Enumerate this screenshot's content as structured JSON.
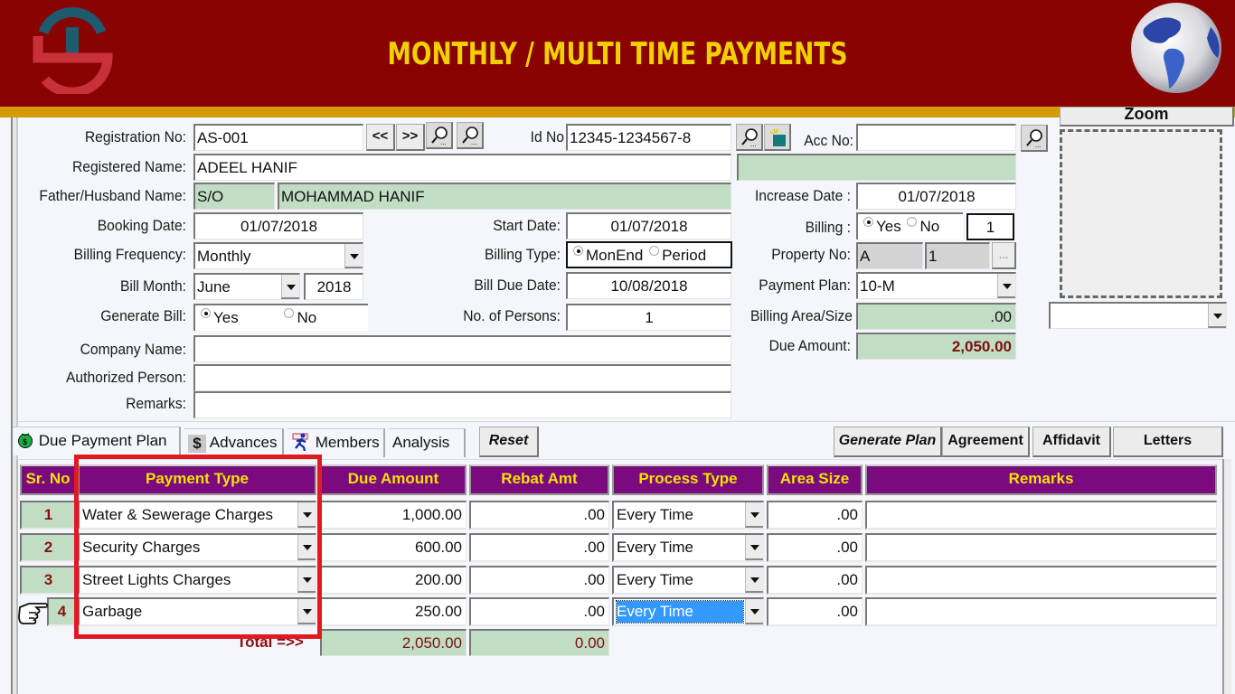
{
  "header": {
    "title": "MONTHLY / MULTI TIME PAYMENTS",
    "colors": {
      "banner": "#8a0303",
      "band": "#d49a08",
      "title": "#f0d000"
    }
  },
  "form": {
    "registration_no": {
      "label": "Registration No:",
      "value": "AS-001"
    },
    "nav": {
      "prev": "<<",
      "next": ">>"
    },
    "id_no": {
      "label": "Id No",
      "value": "12345-1234567-8"
    },
    "acc_no": {
      "label": "Acc No:",
      "value": ""
    },
    "registered_name": {
      "label": "Registered Name:",
      "value": "ADEEL HANIF"
    },
    "registered_name_extra": "",
    "father_husband": {
      "label": "Father/Husband Name:",
      "relation": "S/O",
      "value": "MOHAMMAD HANIF"
    },
    "increase_date": {
      "label": "Increase Date :",
      "value": "01/07/2018"
    },
    "booking_date": {
      "label": "Booking Date:",
      "value": "01/07/2018"
    },
    "start_date": {
      "label": "Start Date:",
      "value": "01/07/2018"
    },
    "billing": {
      "label": "Billing :",
      "options": [
        "Yes",
        "No"
      ],
      "selected": "Yes",
      "count": "1"
    },
    "billing_frequency": {
      "label": "Billing Frequency:",
      "value": "Monthly"
    },
    "billing_type": {
      "label": "Billing Type:",
      "options": [
        "MonEnd",
        "Period"
      ],
      "selected": "MonEnd"
    },
    "property_no": {
      "label": "Property No:",
      "block": "A",
      "number": "1",
      "browse": "..."
    },
    "bill_month": {
      "label": "Bill Month:",
      "month": "June",
      "year": "2018"
    },
    "bill_due_date": {
      "label": "Bill Due Date:",
      "value": "10/08/2018"
    },
    "payment_plan": {
      "label": "Payment Plan:",
      "value": "10-M"
    },
    "generate_bill": {
      "label": "Generate Bill:",
      "options": [
        "Yes",
        "No"
      ],
      "selected": "Yes"
    },
    "no_of_persons": {
      "label": "No. of Persons:",
      "value": "1"
    },
    "billing_area": {
      "label": "Billing Area/Size",
      "value": ".00"
    },
    "due_amount": {
      "label": "Due Amount:",
      "value": "2,050.00"
    },
    "company_name": {
      "label": "Company Name:",
      "value": ""
    },
    "authorized_person": {
      "label": "Authorized Person:",
      "value": ""
    },
    "remarks": {
      "label": "Remarks:",
      "value": ""
    },
    "zoom_button": "Zoom",
    "photo_select": ""
  },
  "tabs": [
    {
      "label": "Due Payment Plan",
      "icon": "money-bag-icon",
      "active": true
    },
    {
      "label": "Advances",
      "icon": "dollar-icon"
    },
    {
      "label": "Members",
      "icon": "running-man-icon"
    },
    {
      "label": "Analysis"
    }
  ],
  "actions": {
    "reset": "Reset",
    "generate_plan": "Generate Plan",
    "agreement": "Agreement",
    "affidavit": "Affidavit",
    "letters": "Letters"
  },
  "grid": {
    "columns": [
      "Sr. No",
      "Payment Type",
      "Due Amount",
      "Rebat Amt",
      "Process Type",
      "Area Size",
      "Remarks"
    ],
    "rows": [
      {
        "sr": "1",
        "payment_type": "Water & Sewerage Charges",
        "due_amount": "1,000.00",
        "rebate": ".00",
        "process_type": "Every Time",
        "area_size": ".00",
        "remarks": ""
      },
      {
        "sr": "2",
        "payment_type": "Security Charges",
        "due_amount": "600.00",
        "rebate": ".00",
        "process_type": "Every Time",
        "area_size": ".00",
        "remarks": ""
      },
      {
        "sr": "3",
        "payment_type": "Street Lights Charges",
        "due_amount": "200.00",
        "rebate": ".00",
        "process_type": "Every Time",
        "area_size": ".00",
        "remarks": ""
      },
      {
        "sr": "4",
        "payment_type": "Garbage",
        "due_amount": "250.00",
        "rebate": ".00",
        "process_type": "Every Time",
        "area_size": ".00",
        "remarks": "",
        "current": true
      }
    ],
    "total_label": "Total =>>",
    "total_due": "2,050.00",
    "total_rebate": "0.00",
    "colors": {
      "header_bg": "#7b0a7e",
      "header_text": "#f4e100",
      "highlight_box": "#e01a22",
      "selection": "#3399ff"
    }
  }
}
